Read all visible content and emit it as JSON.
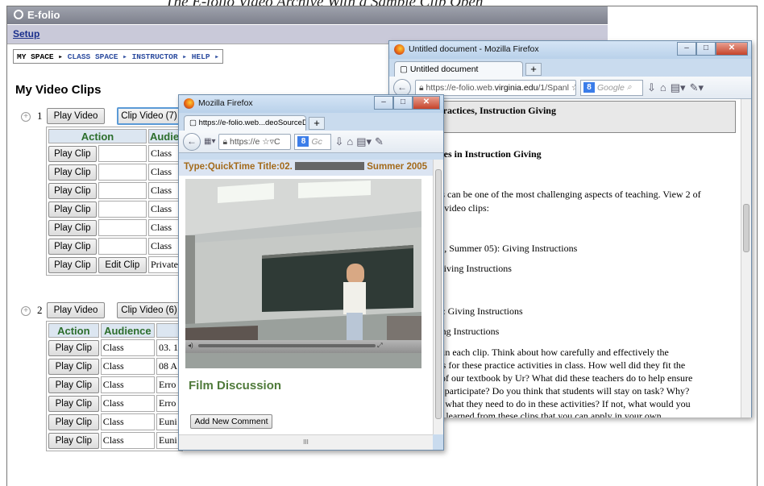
{
  "caption": "The E-folio Video Archive With a Sample Clip Open",
  "app": {
    "title": "E-folio",
    "setup_label": "Setup"
  },
  "breadcrumb": {
    "my_space": "MY SPACE ▸",
    "class_space": "CLASS SPACE ▸",
    "instructor": "INSTRUCTOR ▸",
    "help": "HELP ▸"
  },
  "page_title": "My Video Clips",
  "group1": {
    "number": "1",
    "play_video_label": "Play Video",
    "clip_video_label": "Clip Video (7)",
    "headers": [
      "Action",
      "Audie"
    ],
    "rows": [
      {
        "play": "Play Clip",
        "edit": "",
        "audience": "Class"
      },
      {
        "play": "Play Clip",
        "edit": "",
        "audience": "Class"
      },
      {
        "play": "Play Clip",
        "edit": "",
        "audience": "Class"
      },
      {
        "play": "Play Clip",
        "edit": "",
        "audience": "Class"
      },
      {
        "play": "Play Clip",
        "edit": "",
        "audience": "Class"
      },
      {
        "play": "Play Clip",
        "edit": "",
        "audience": "Class"
      },
      {
        "play": "Play Clip",
        "edit": "Edit Clip",
        "audience": "Private"
      }
    ]
  },
  "group2": {
    "number": "2",
    "play_video_label": "Play Video",
    "clip_video_label": "Clip Video (6)",
    "headers": [
      "Action",
      "Audience"
    ],
    "rows": [
      {
        "play": "Play Clip",
        "audience": "Class",
        "title": "03. 1"
      },
      {
        "play": "Play Clip",
        "audience": "Class",
        "title": "08 A"
      },
      {
        "play": "Play Clip",
        "audience": "Class",
        "title": "Erro"
      },
      {
        "play": "Play Clip",
        "audience": "Class",
        "title": "Erro"
      },
      {
        "play": "Play Clip",
        "audience": "Class",
        "title": "Euni"
      },
      {
        "play": "Play Clip",
        "audience": "Class",
        "title": "Euni"
      }
    ]
  },
  "doc_window": {
    "title": "Untitled document - Mozilla Firefox",
    "tab_label": "Untitled document",
    "url_prefix": "https://e-folio.web.",
    "url_domain": "virginia.edu",
    "url_suffix": "/1/Spanl",
    "search_placeholder": "Google",
    "heading1": "ity 4, Best Practices, Instruction Giving",
    "heading2": "Best Practices in Instruction Giving",
    "lines": [
      "r instructions can be one of the most challenging aspects of teaching.  View 2 of",
      "g 4 premade video clips:",
      "s (SPAN 101, Summer 05): Giving Instructions",
      "05, Diane: Giving Instructions",
      "ntation 2010: Giving Instructions",
      "[ 2010: Giving Instructions",
      "hat happens in each clip.  Think about how carefully and effectively the",
      "e instructions for these practice activities in class.  How well did they fit the",
      "n pp. 16-17 of our textbook by Ur?  What did these teachers do to help ensure",
      "udent  would participate?  Do you think that students will stay on task?  Why?",
      "s understand what they need to do in these activities?  If not, what would you",
      "hat have you learned from these clips that you can apply in your own"
    ]
  },
  "video_window": {
    "title": "Mozilla Firefox",
    "tab_label": "https://e-folio.web...deoSourceDetail.CFM",
    "url": "https://e",
    "search_placeholder": "Gc",
    "type_label": "Type:QuickTime  Title:02.",
    "title_suffix": "Summer 2005",
    "discussion_heading": "Film Discussion",
    "add_comment_label": "Add New Comment",
    "hscroll_mark": "III"
  }
}
